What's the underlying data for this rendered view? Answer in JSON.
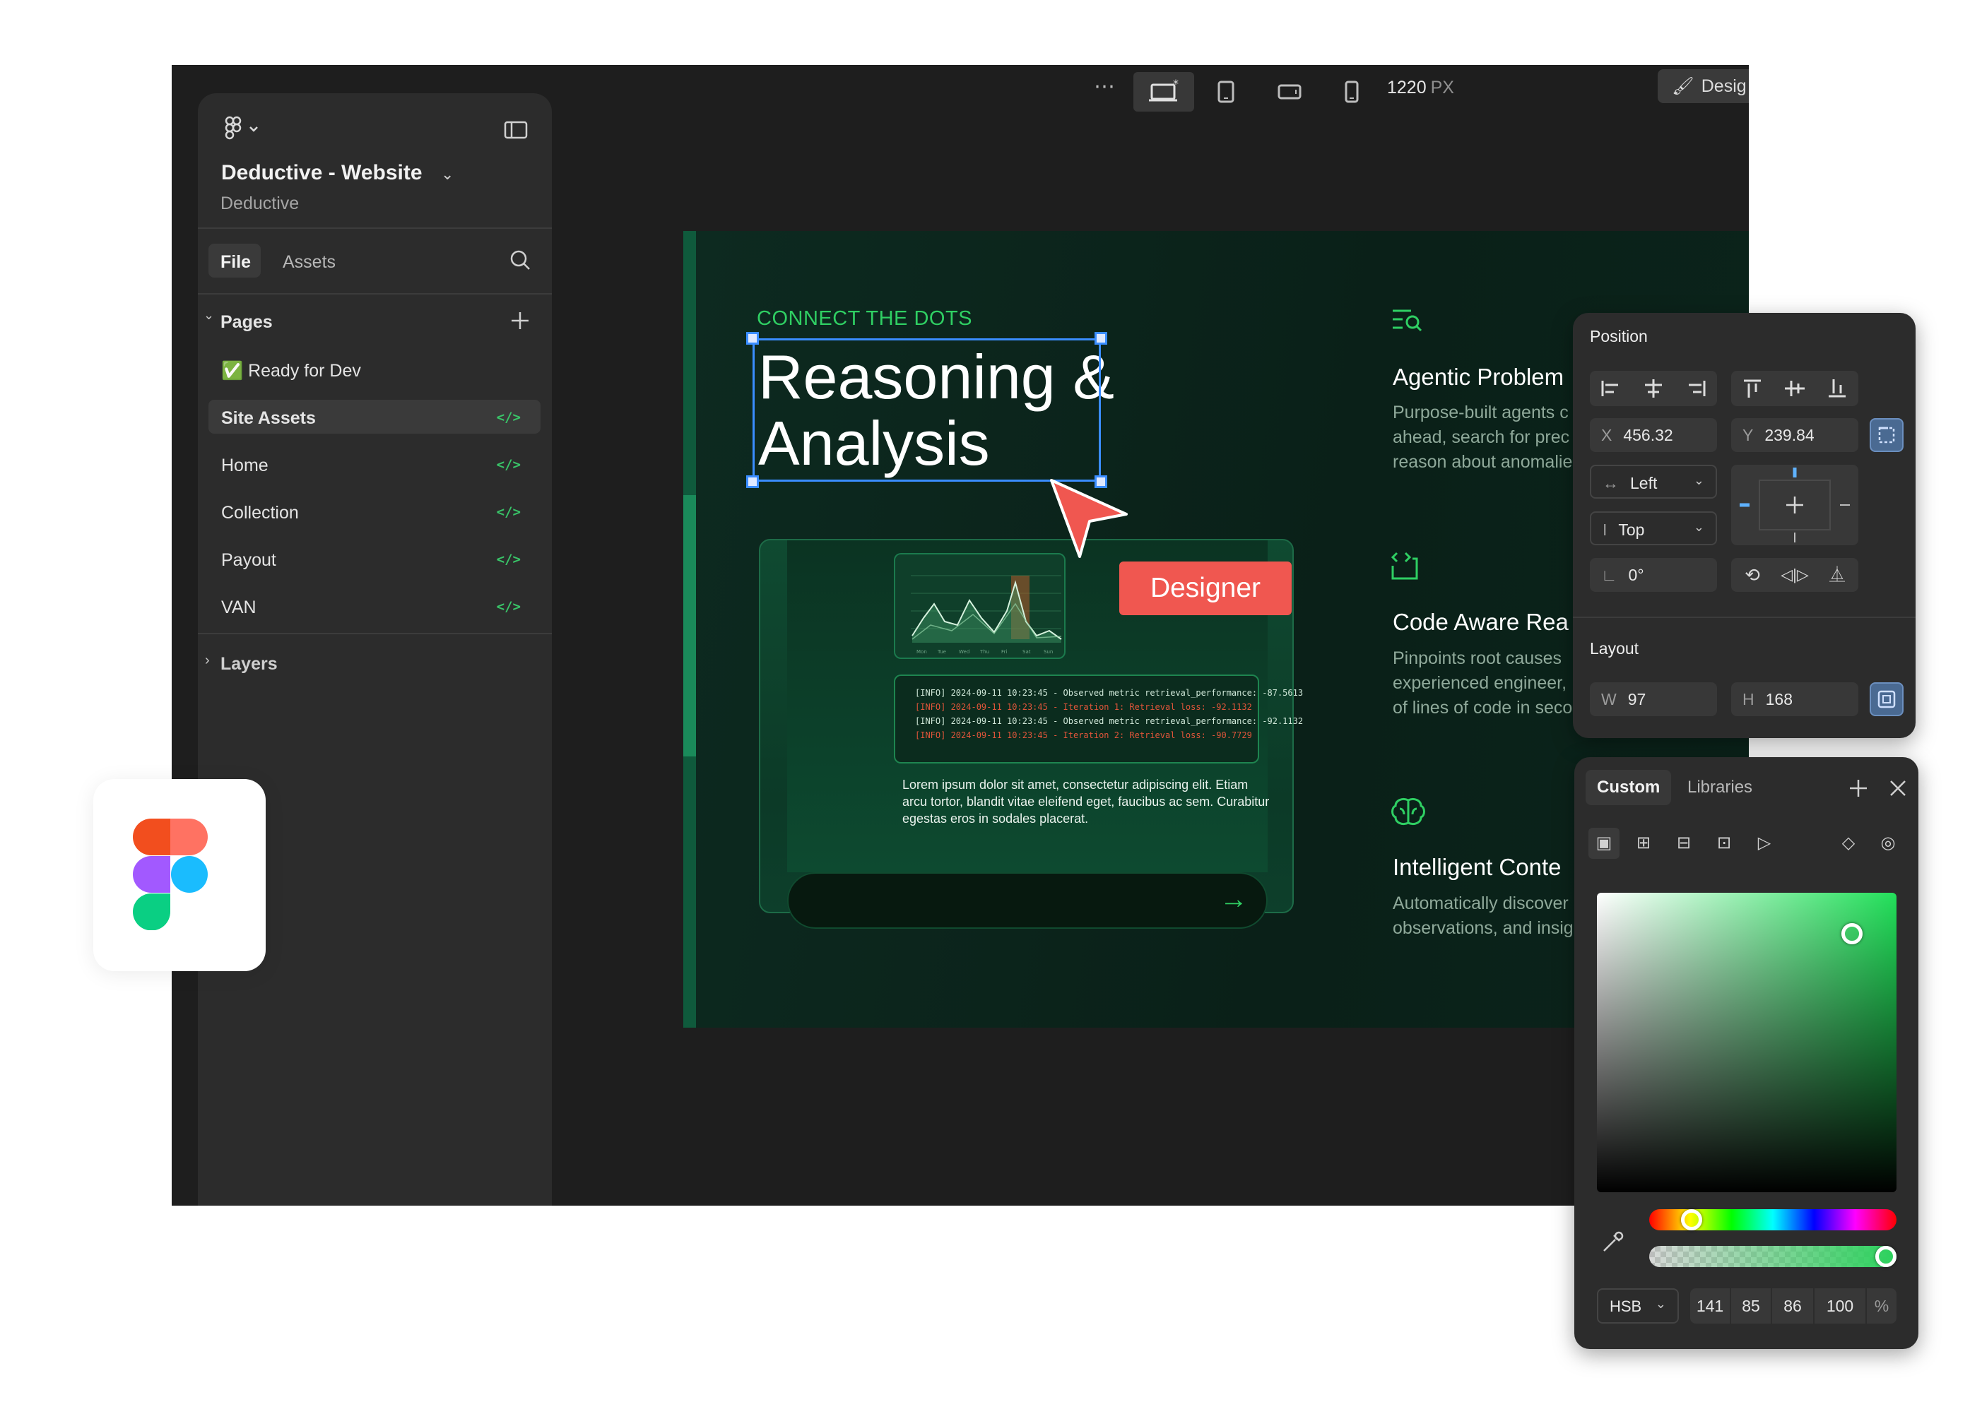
{
  "toolbar": {
    "width_value": "1220",
    "width_unit": "PX",
    "design_label": "Desig"
  },
  "sidebar": {
    "project_name": "Deductive - Website",
    "team_name": "Deductive",
    "tabs": {
      "file": "File",
      "assets": "Assets"
    },
    "pages_label": "Pages",
    "pages": [
      {
        "label": "✅ Ready for Dev",
        "has_code": false
      },
      {
        "label": "Site Assets",
        "has_code": true,
        "selected": true
      },
      {
        "label": "Home",
        "has_code": true
      },
      {
        "label": "Collection",
        "has_code": true
      },
      {
        "label": "Payout",
        "has_code": true
      },
      {
        "label": "VAN",
        "has_code": true
      }
    ],
    "code_glyph": "</>",
    "layers_label": "Layers"
  },
  "canvas": {
    "eyebrow": "CONNECT THE DOTS",
    "headline": "Reasoning &\nAnalysis",
    "log_lines": [
      {
        "text": "[INFO] 2024-09-11 10:23:45 - Observed metric retrieval_performance: -87.5613",
        "level": "info"
      },
      {
        "text": "[INFO] 2024-09-11 10:23:45 - Iteration 1: Retrieval loss: -92.1132",
        "level": "error"
      },
      {
        "text": "[INFO] 2024-09-11 10:23:45 - Observed metric retrieval_performance: -92.1132",
        "level": "info"
      },
      {
        "text": "[INFO] 2024-09-11 10:23:45 - Iteration 2: Retrieval loss: -90.7729",
        "level": "error"
      }
    ],
    "lorem": "Lorem ipsum dolor sit amet, consectetur adipiscing elit. Etiam arcu tortor, blandit vitae eleifend eget, faucibus ac sem. Curabitur egestas eros in sodales placerat.",
    "features": [
      {
        "icon": "search-list-icon",
        "title": "Agentic Problem",
        "desc": "Purpose-built agents c\nahead, search for prec\nreason about anomalie"
      },
      {
        "icon": "code-bracket-icon",
        "title": "Code Aware Rea",
        "desc": "Pinpoints root causes\nexperienced engineer,\nof lines of code in seco"
      },
      {
        "icon": "brain-icon",
        "title": "Intelligent Conte",
        "desc": "Automatically discover\nobservations, and insig"
      }
    ],
    "designer_tag": "Designer"
  },
  "position_panel": {
    "position_label": "Position",
    "x_key": "X",
    "x_value": "456.32",
    "y_key": "Y",
    "y_value": "239.84",
    "h_constraint": "Left",
    "v_constraint": "Top",
    "rotation": "0°",
    "layout_label": "Layout",
    "w_key": "W",
    "w_value": "97",
    "h_key": "H",
    "h_value": "168"
  },
  "color_panel": {
    "tabs": {
      "custom": "Custom",
      "libraries": "Libraries"
    },
    "mode": "HSB",
    "h": "141",
    "s": "85",
    "b": "86",
    "alpha": "100",
    "alpha_unit": "%",
    "hue_position": 0.141,
    "alpha_position": 1.0
  },
  "colors": {
    "accent_green": "#2fcf63",
    "designer_red": "#f05750",
    "selection_blue": "#3a8dff",
    "panel_bg": "#2c2c2c"
  }
}
